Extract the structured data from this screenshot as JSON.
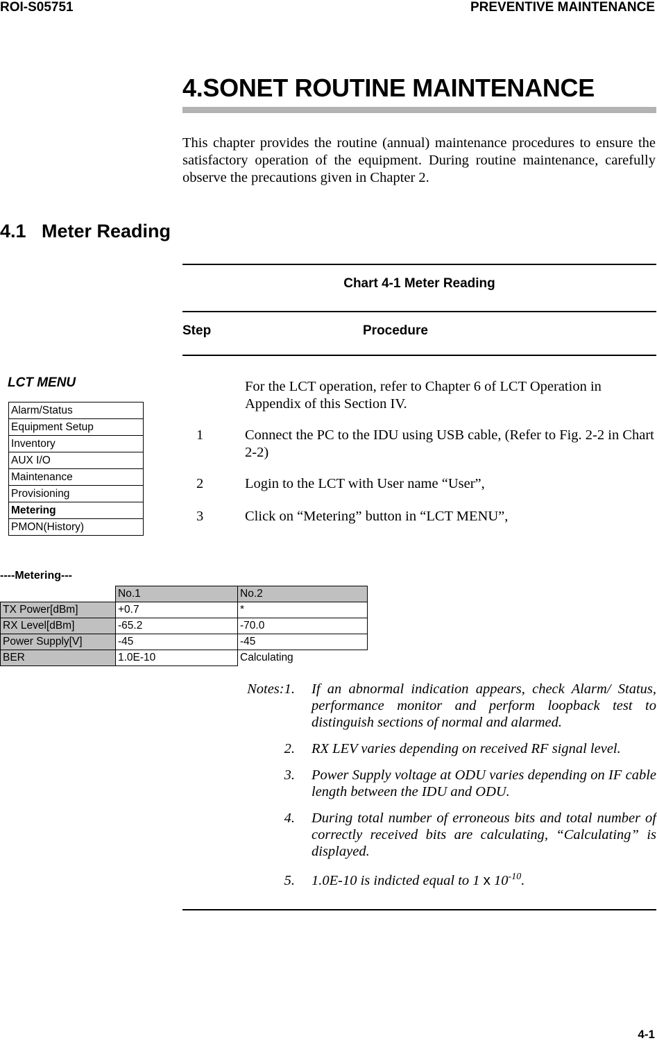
{
  "header": {
    "doc_id": "ROI-S05751",
    "section": "PREVENTIVE MAINTENANCE"
  },
  "chapter": {
    "title": "4.SONET ROUTINE MAINTENANCE",
    "intro": "This chapter provides the routine (annual) maintenance procedures to ensure the satisfactory operation of the equipment. During routine maintenance, carefully observe the precautions given in Chapter 2."
  },
  "section": {
    "number": "4.1",
    "title": "Meter Reading"
  },
  "chart": {
    "title": "Chart 4-1  Meter Reading",
    "col_step": "Step",
    "col_procedure": "Procedure",
    "steps": [
      {
        "num": "",
        "text": "For the LCT operation, refer to Chapter 6 of LCT Operation in Appendix of this Section IV."
      },
      {
        "num": "1",
        "text": "Connect the PC to the IDU using USB cable, (Refer to Fig. 2-2 in Chart 2-2)"
      },
      {
        "num": "2",
        "text": "Login to the LCT with User name “User”,"
      },
      {
        "num": "3",
        "text": "Click on “Metering” button in “LCT MENU”,"
      }
    ]
  },
  "lct_menu": {
    "title": "LCT MENU",
    "items": [
      {
        "label": "Alarm/Status",
        "selected": false
      },
      {
        "label": "Equipment Setup",
        "selected": false
      },
      {
        "label": "Inventory",
        "selected": false
      },
      {
        "label": "AUX I/O",
        "selected": false
      },
      {
        "label": "Maintenance",
        "selected": false
      },
      {
        "label": "Provisioning",
        "selected": false
      },
      {
        "label": "Metering",
        "selected": true
      },
      {
        "label": "PMON(History)",
        "selected": false
      }
    ]
  },
  "metering": {
    "title": "----Metering---",
    "columns": [
      "",
      "No.1",
      "No.2"
    ],
    "rows": [
      {
        "label": "TX Power[dBm]",
        "no1": "+0.7",
        "no2": "*"
      },
      {
        "label": "RX Level[dBm]",
        "no1": "-65.2",
        "no2": "-70.0"
      },
      {
        "label": "Power Supply[V]",
        "no1": "-45",
        "no2": "-45"
      },
      {
        "label": "BER",
        "no1": "1.0E-10",
        "no2": "Calculating"
      }
    ]
  },
  "notes": {
    "lead": "Notes:",
    "items": [
      {
        "num": "1.",
        "text": "If an abnormal indication appears, check Alarm/ Status, performance monitor and perform loopback test to distinguish sections of normal and alarmed."
      },
      {
        "num": "2.",
        "text": "RX LEV varies depending on received RF signal level."
      },
      {
        "num": "3.",
        "text": "Power Supply voltage at ODU varies depending on IF cable length between the IDU and ODU."
      },
      {
        "num": "4.",
        "text": "During total number of erroneous bits and total number of correctly received bits are calculating, “Calculating” is displayed."
      },
      {
        "num": "5.",
        "text_pre": "1.0E-10 is indicted equal to 1 ",
        "times": "x",
        "base": " 10",
        "exponent": "-10",
        "text_post": "."
      }
    ]
  },
  "footer": {
    "page": "4-1"
  }
}
